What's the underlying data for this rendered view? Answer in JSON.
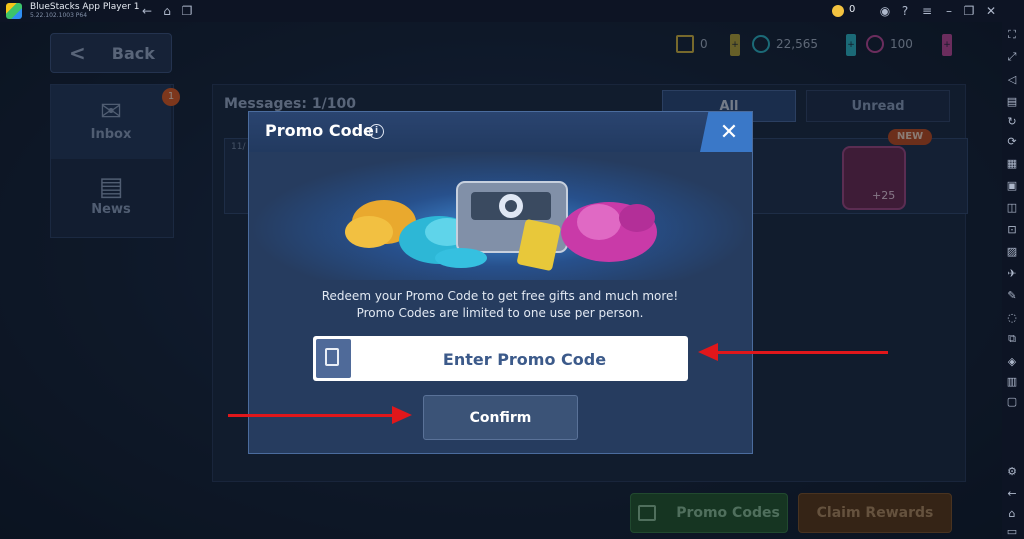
{
  "window": {
    "app_title": "BlueStacks App Player 1",
    "version": "5.22.102.1003 P64",
    "coin_count": "0"
  },
  "game": {
    "back_label": "Back",
    "currencies": [
      {
        "name": "triangle-token",
        "value": "0",
        "color": "#d6b640"
      },
      {
        "name": "credits",
        "value": "22,565",
        "color": "#2fb8c9"
      },
      {
        "name": "a-token",
        "value": "100",
        "color": "#c04a9a"
      }
    ],
    "tabs": {
      "inbox": "Inbox",
      "news": "News",
      "inbox_badge": "1"
    },
    "messages_label": "Messages:",
    "messages_count": "1/100",
    "filters": {
      "all": "All",
      "unread": "Unread"
    },
    "row": {
      "date": "11/",
      "new_badge": "NEW",
      "reward_amount": "+25"
    },
    "bottom_buttons": {
      "promo_codes": "Promo Codes",
      "claim_rewards": "Claim Rewards"
    }
  },
  "modal": {
    "title": "Promo Code",
    "close_glyph": "✕",
    "info_glyph": "i",
    "description_line1": "Redeem your Promo Code to get free gifts and much more!",
    "description_line2": "Promo Codes are limited to one use per person.",
    "input_placeholder": "Enter Promo Code",
    "input_value": "",
    "confirm_label": "Confirm"
  },
  "colors": {
    "annotation_arrow": "#e0171b",
    "modal_bg": "#263c5f",
    "close_button": "#3a78c8"
  }
}
